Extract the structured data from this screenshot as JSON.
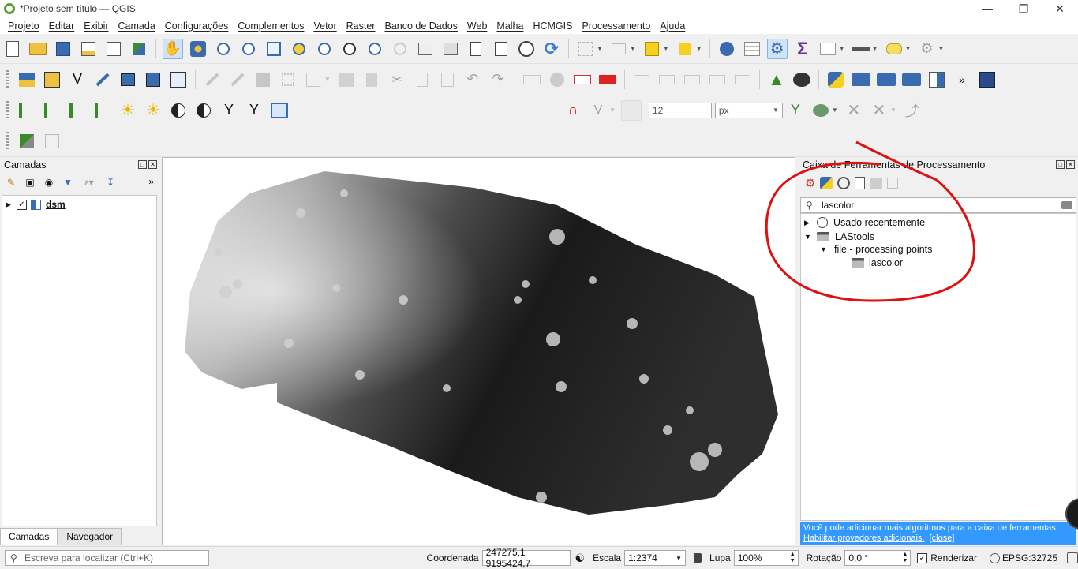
{
  "window": {
    "title": "*Projeto sem título — QGIS"
  },
  "menu": [
    "Projeto",
    "Editar",
    "Exibir",
    "Camada",
    "Configurações",
    "Complementos",
    "Vetor",
    "Raster",
    "Banco de Dados",
    "Web",
    "Malha",
    "HCMGIS",
    "Processamento",
    "Ajuda"
  ],
  "toolbar3": {
    "snap_tolerance": "12",
    "snap_unit": "px"
  },
  "layers_panel": {
    "title": "Camadas",
    "layer_name": "dsm",
    "tabs": [
      "Camadas",
      "Navegador"
    ]
  },
  "toolbox": {
    "title": "Caixa de Ferramentas de Processamento",
    "search_value": "lascolor",
    "tree": {
      "recent": "Usado recentemente",
      "provider": "LAStools",
      "group": "file - processing points",
      "algorithm": "lascolor"
    },
    "info_text": "Você pode adicionar mais algoritmos para a caixa de ferramentas.",
    "info_link": "Habilitar provedores adicionais.",
    "info_close": "[close]"
  },
  "status": {
    "locator_placeholder": "Escreva para localizar (Ctrl+K)",
    "coord_label": "Coordenada",
    "coord_value": "247275,1 9195424,7",
    "scale_label": "Escala",
    "scale_value": "1:2374",
    "magnifier_label": "Lupa",
    "magnifier_value": "100%",
    "rotation_label": "Rotação",
    "rotation_value": "0,0 °",
    "render_label": "Renderizar",
    "crs": "EPSG:32725"
  },
  "colors": {
    "accent_blue": "#3399ff",
    "annotation_red": "#e01010",
    "qgis_green": "#5a9e32"
  }
}
